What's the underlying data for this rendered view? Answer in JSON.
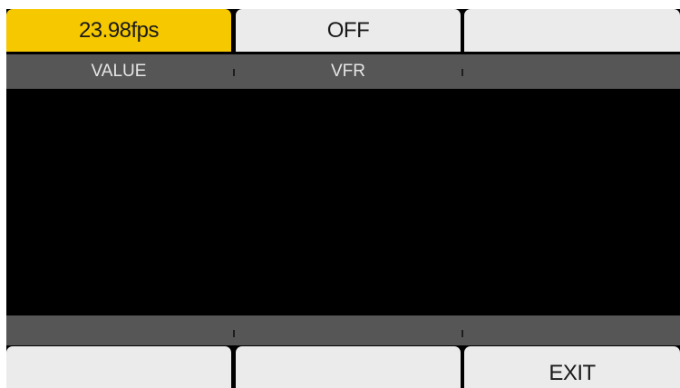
{
  "top_buttons": [
    {
      "label": "23.98fps",
      "selected": true
    },
    {
      "label": "OFF",
      "selected": false
    },
    {
      "label": "",
      "selected": false
    }
  ],
  "top_labels": [
    "VALUE",
    "VFR",
    ""
  ],
  "bottom_buttons": [
    {
      "label": ""
    },
    {
      "label": ""
    },
    {
      "label": "EXIT"
    }
  ],
  "colors": {
    "selected": "#f5c800",
    "button": "#ebebeb",
    "label_bar": "#565656",
    "background": "#000000"
  }
}
